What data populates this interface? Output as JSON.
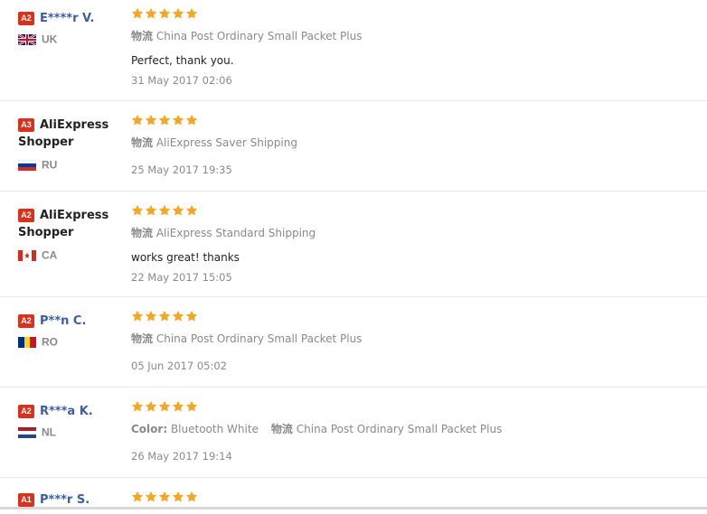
{
  "ratings": {
    "star_color": "#f5a623"
  },
  "shipping_label": "物流",
  "color_label": "Color:",
  "reviews": [
    {
      "level": "A2",
      "name_line1": "E****r V.",
      "name_line2": "",
      "country": "UK",
      "stars": 5,
      "color_value": "",
      "shipping": "China Post Ordinary Small Packet Plus",
      "comment": "Perfect, thank you.",
      "date": "31 May 2017 02:06"
    },
    {
      "level": "A3",
      "name_line1": "AliExpress",
      "name_line2": "Shopper",
      "country": "RU",
      "stars": 5,
      "color_value": "",
      "shipping": "AliExpress Saver Shipping",
      "comment": "",
      "date": "25 May 2017 19:35"
    },
    {
      "level": "A2",
      "name_line1": "AliExpress",
      "name_line2": "Shopper",
      "country": "CA",
      "stars": 5,
      "color_value": "",
      "shipping": "AliExpress Standard Shipping",
      "comment": "works great! thanks",
      "date": "22 May 2017 15:05"
    },
    {
      "level": "A2",
      "name_line1": "P**n C.",
      "name_line2": "",
      "country": "RO",
      "stars": 5,
      "color_value": "",
      "shipping": "China Post Ordinary Small Packet Plus",
      "comment": "",
      "date": "05 Jun 2017 05:02"
    },
    {
      "level": "A2",
      "name_line1": "R***a K.",
      "name_line2": "",
      "country": "NL",
      "stars": 5,
      "color_value": "Bluetooth White",
      "shipping": "China Post Ordinary Small Packet Plus",
      "comment": "",
      "date": "26 May 2017 19:14"
    },
    {
      "level": "A1",
      "name_line1": "P***r S.",
      "name_line2": "",
      "country": "",
      "stars": 5,
      "color_value": "",
      "shipping": "",
      "comment": "",
      "date": ""
    }
  ]
}
